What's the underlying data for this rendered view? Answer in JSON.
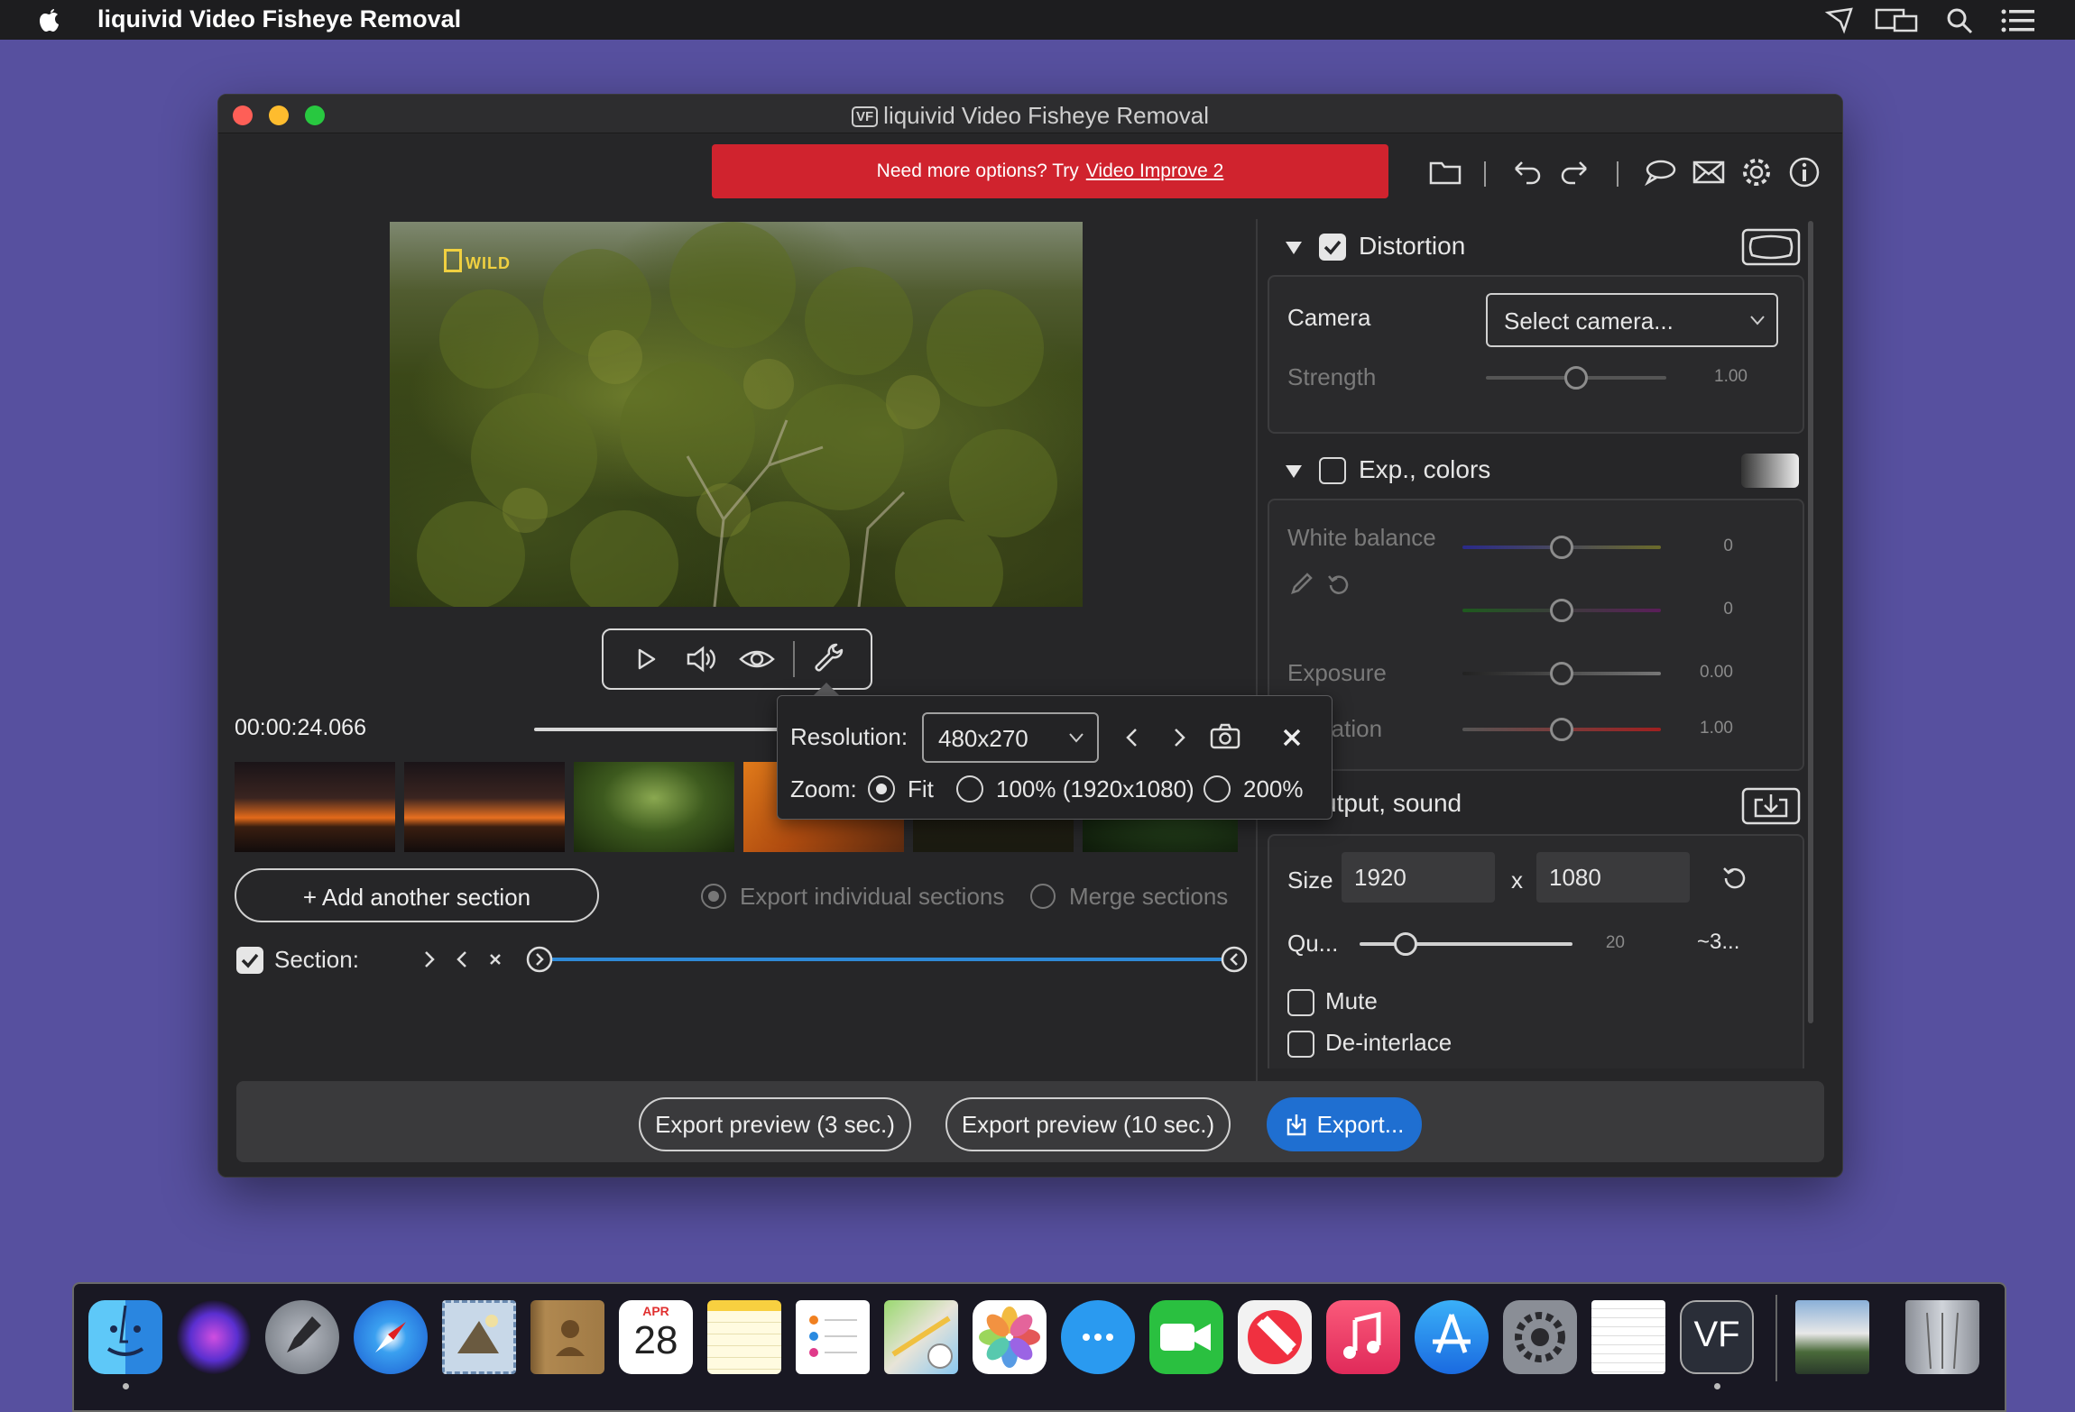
{
  "menubar": {
    "app_title": "liquivid Video Fisheye Removal"
  },
  "window": {
    "title": "liquivid Video Fisheye Removal",
    "title_badge": "VF",
    "promo": {
      "text": "Need more options? Try",
      "link": "Video Improve 2"
    }
  },
  "toolbar_icons": [
    "folder-icon",
    "undo-icon",
    "redo-icon",
    "speech-bubble-icon",
    "mail-icon",
    "gear-icon",
    "info-icon"
  ],
  "preview": {
    "watermark": "WILD"
  },
  "playback": {
    "timecode": "00:00:24.066",
    "controls": [
      "play-icon",
      "speaker-icon",
      "eye-icon",
      "wrench-icon"
    ]
  },
  "popover": {
    "resolution_label": "Resolution:",
    "resolution_value": "480x270",
    "zoom_label": "Zoom:",
    "zoom_options": [
      "Fit",
      "100% (1920x1080)",
      "200%"
    ],
    "zoom_selected": "Fit"
  },
  "sections": {
    "add_button": "+ Add another section",
    "export_individual": "Export individual sections",
    "merge": "Merge sections",
    "section_label": "Section:",
    "section_checked": true
  },
  "distortion": {
    "header": "Distortion",
    "enabled": true,
    "camera_label": "Camera",
    "camera_placeholder": "Select camera...",
    "strength_label": "Strength",
    "strength_value": "1.00",
    "strength_fraction": 0.5
  },
  "exp_colors": {
    "header": "Exp., colors",
    "enabled": false,
    "white_balance_label": "White balance",
    "wb1_value": "0",
    "wb2_value": "0",
    "exposure_label": "Exposure",
    "exposure_value": "0.00",
    "saturation_label_visible": "ration",
    "saturation_value": "1.00"
  },
  "output": {
    "header_visible": "utput, sound",
    "size_label": "Size",
    "width": "1920",
    "x_label": "x",
    "height": "1080",
    "quality_label": "Qu...",
    "quality_value": "20",
    "quality_estimate": "~3...",
    "quality_fraction": 0.2,
    "mute_label": "Mute",
    "deinterlace_label": "De-interlace"
  },
  "bottom": {
    "preview3": "Export preview (3 sec.)",
    "preview10": "Export preview (10 sec.)",
    "export": "Export..."
  },
  "dock": {
    "calendar_month": "APR",
    "calendar_day": "28",
    "vf_label": "VF",
    "icons": [
      "finder-icon",
      "siri-icon",
      "launchpad-icon",
      "safari-icon",
      "mail-stamp-icon",
      "contacts-icon",
      "calendar-icon",
      "notes-icon",
      "reminders-icon",
      "maps-icon",
      "photos-icon",
      "messages-icon",
      "facetime-icon",
      "news-icon",
      "music-icon",
      "app-store-icon",
      "system-preferences-icon",
      "textedit-icon",
      "fisheye-app-icon",
      "downloads-stack-icon",
      "trash-icon"
    ]
  },
  "colors": {
    "promo_red": "#d0232e",
    "accent_blue": "#1f6fd1",
    "desktop": "#57509f"
  }
}
